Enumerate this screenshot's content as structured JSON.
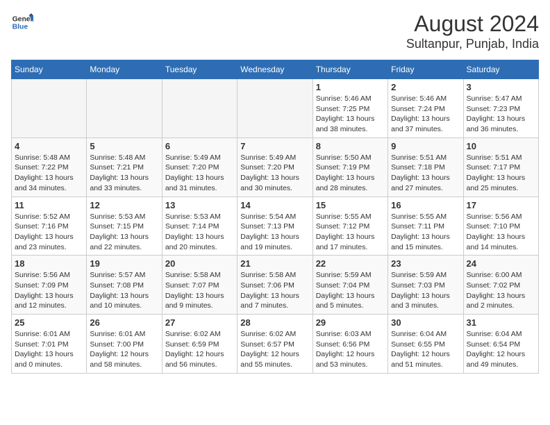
{
  "logo": {
    "line1": "General",
    "line2": "Blue"
  },
  "title": "August 2024",
  "subtitle": "Sultanpur, Punjab, India",
  "days_of_week": [
    "Sunday",
    "Monday",
    "Tuesday",
    "Wednesday",
    "Thursday",
    "Friday",
    "Saturday"
  ],
  "weeks": [
    [
      {
        "day": "",
        "info": ""
      },
      {
        "day": "",
        "info": ""
      },
      {
        "day": "",
        "info": ""
      },
      {
        "day": "",
        "info": ""
      },
      {
        "day": "1",
        "info": "Sunrise: 5:46 AM\nSunset: 7:25 PM\nDaylight: 13 hours\nand 38 minutes."
      },
      {
        "day": "2",
        "info": "Sunrise: 5:46 AM\nSunset: 7:24 PM\nDaylight: 13 hours\nand 37 minutes."
      },
      {
        "day": "3",
        "info": "Sunrise: 5:47 AM\nSunset: 7:23 PM\nDaylight: 13 hours\nand 36 minutes."
      }
    ],
    [
      {
        "day": "4",
        "info": "Sunrise: 5:48 AM\nSunset: 7:22 PM\nDaylight: 13 hours\nand 34 minutes."
      },
      {
        "day": "5",
        "info": "Sunrise: 5:48 AM\nSunset: 7:21 PM\nDaylight: 13 hours\nand 33 minutes."
      },
      {
        "day": "6",
        "info": "Sunrise: 5:49 AM\nSunset: 7:20 PM\nDaylight: 13 hours\nand 31 minutes."
      },
      {
        "day": "7",
        "info": "Sunrise: 5:49 AM\nSunset: 7:20 PM\nDaylight: 13 hours\nand 30 minutes."
      },
      {
        "day": "8",
        "info": "Sunrise: 5:50 AM\nSunset: 7:19 PM\nDaylight: 13 hours\nand 28 minutes."
      },
      {
        "day": "9",
        "info": "Sunrise: 5:51 AM\nSunset: 7:18 PM\nDaylight: 13 hours\nand 27 minutes."
      },
      {
        "day": "10",
        "info": "Sunrise: 5:51 AM\nSunset: 7:17 PM\nDaylight: 13 hours\nand 25 minutes."
      }
    ],
    [
      {
        "day": "11",
        "info": "Sunrise: 5:52 AM\nSunset: 7:16 PM\nDaylight: 13 hours\nand 23 minutes."
      },
      {
        "day": "12",
        "info": "Sunrise: 5:53 AM\nSunset: 7:15 PM\nDaylight: 13 hours\nand 22 minutes."
      },
      {
        "day": "13",
        "info": "Sunrise: 5:53 AM\nSunset: 7:14 PM\nDaylight: 13 hours\nand 20 minutes."
      },
      {
        "day": "14",
        "info": "Sunrise: 5:54 AM\nSunset: 7:13 PM\nDaylight: 13 hours\nand 19 minutes."
      },
      {
        "day": "15",
        "info": "Sunrise: 5:55 AM\nSunset: 7:12 PM\nDaylight: 13 hours\nand 17 minutes."
      },
      {
        "day": "16",
        "info": "Sunrise: 5:55 AM\nSunset: 7:11 PM\nDaylight: 13 hours\nand 15 minutes."
      },
      {
        "day": "17",
        "info": "Sunrise: 5:56 AM\nSunset: 7:10 PM\nDaylight: 13 hours\nand 14 minutes."
      }
    ],
    [
      {
        "day": "18",
        "info": "Sunrise: 5:56 AM\nSunset: 7:09 PM\nDaylight: 13 hours\nand 12 minutes."
      },
      {
        "day": "19",
        "info": "Sunrise: 5:57 AM\nSunset: 7:08 PM\nDaylight: 13 hours\nand 10 minutes."
      },
      {
        "day": "20",
        "info": "Sunrise: 5:58 AM\nSunset: 7:07 PM\nDaylight: 13 hours\nand 9 minutes."
      },
      {
        "day": "21",
        "info": "Sunrise: 5:58 AM\nSunset: 7:06 PM\nDaylight: 13 hours\nand 7 minutes."
      },
      {
        "day": "22",
        "info": "Sunrise: 5:59 AM\nSunset: 7:04 PM\nDaylight: 13 hours\nand 5 minutes."
      },
      {
        "day": "23",
        "info": "Sunrise: 5:59 AM\nSunset: 7:03 PM\nDaylight: 13 hours\nand 3 minutes."
      },
      {
        "day": "24",
        "info": "Sunrise: 6:00 AM\nSunset: 7:02 PM\nDaylight: 13 hours\nand 2 minutes."
      }
    ],
    [
      {
        "day": "25",
        "info": "Sunrise: 6:01 AM\nSunset: 7:01 PM\nDaylight: 13 hours\nand 0 minutes."
      },
      {
        "day": "26",
        "info": "Sunrise: 6:01 AM\nSunset: 7:00 PM\nDaylight: 12 hours\nand 58 minutes."
      },
      {
        "day": "27",
        "info": "Sunrise: 6:02 AM\nSunset: 6:59 PM\nDaylight: 12 hours\nand 56 minutes."
      },
      {
        "day": "28",
        "info": "Sunrise: 6:02 AM\nSunset: 6:57 PM\nDaylight: 12 hours\nand 55 minutes."
      },
      {
        "day": "29",
        "info": "Sunrise: 6:03 AM\nSunset: 6:56 PM\nDaylight: 12 hours\nand 53 minutes."
      },
      {
        "day": "30",
        "info": "Sunrise: 6:04 AM\nSunset: 6:55 PM\nDaylight: 12 hours\nand 51 minutes."
      },
      {
        "day": "31",
        "info": "Sunrise: 6:04 AM\nSunset: 6:54 PM\nDaylight: 12 hours\nand 49 minutes."
      }
    ]
  ]
}
